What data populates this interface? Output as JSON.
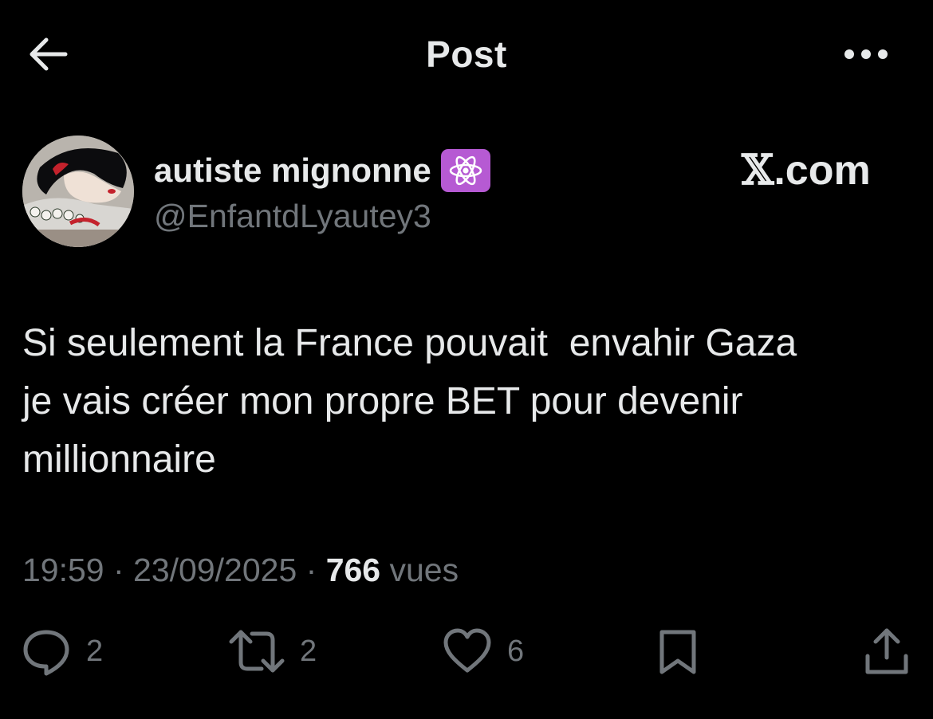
{
  "header": {
    "title": "Post",
    "back_icon": "arrow-left-icon",
    "more_icon": "more-horizontal-icon"
  },
  "author": {
    "display_name": "autiste mignonne",
    "handle": "@EnfantdLyautey3",
    "badge_icon": "atom-symbol-icon",
    "badge_color": "#b65ad3"
  },
  "watermark": {
    "x": "𝕏",
    "suffix": ".com"
  },
  "post": {
    "lines": [
      "Si seulement la France pouvait  envahir Gaza",
      "je vais créer mon propre BET pour devenir",
      "millionnaire"
    ]
  },
  "meta": {
    "time": "19:59",
    "separator": " · ",
    "date": "23/09/2025",
    "views_count": "766",
    "views_label": " vues"
  },
  "actions": {
    "reply_count": "2",
    "repost_count": "2",
    "like_count": "6"
  },
  "colors": {
    "background": "#000000",
    "primary_text": "#e7e9ea",
    "secondary_text": "#71767b"
  }
}
